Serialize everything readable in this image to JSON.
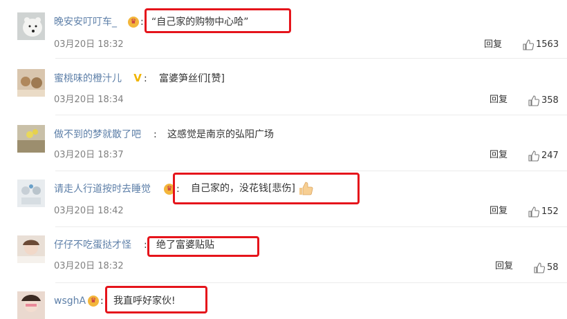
{
  "comments": [
    {
      "name": "晚安安叮叮车_",
      "badge": "crown",
      "colon": ":",
      "text": "“自己家的购物中心哈”",
      "time": "03月20日 18:32",
      "reply": "回复",
      "likes": "1563"
    },
    {
      "name": "蜜桃味的橙汁儿",
      "badge": "v",
      "colon": ":",
      "text": "富婆笋丝们[赞]",
      "time": "03月20日 18:34",
      "reply": "回复",
      "likes": "358"
    },
    {
      "name": "做不到的梦就散了吧",
      "badge": "",
      "colon": ":",
      "text": "这感觉是南京的弘阳广场",
      "time": "03月20日 18:37",
      "reply": "回复",
      "likes": "247"
    },
    {
      "name": "请走人行道按时去睡觉",
      "badge": "crown",
      "colon": ":",
      "text": "自己家的，没花钱[悲伤]",
      "time": "03月20日 18:42",
      "reply": "回复",
      "likes": "152"
    },
    {
      "name": "仔仔不吃蛋挞才怪",
      "badge": "",
      "colon": ":",
      "text": "绝了富婆贴贴",
      "time": "03月20日 18:32",
      "reply": "回复",
      "likes": "58"
    },
    {
      "name": "wsghA",
      "badge": "crown",
      "colon": ":",
      "text": "我直呼好家伙!",
      "time": "",
      "reply": "",
      "likes": ""
    }
  ],
  "colors": {
    "name": "#5d7fa8",
    "highlight": "#e5141b",
    "badge_crown": "#f3b63b",
    "text": "#333333",
    "time": "#808080"
  },
  "icons": {
    "like": "thumbs-up-icon",
    "badge_crown": "crown-icon",
    "badge_v": "v-badge-icon"
  }
}
